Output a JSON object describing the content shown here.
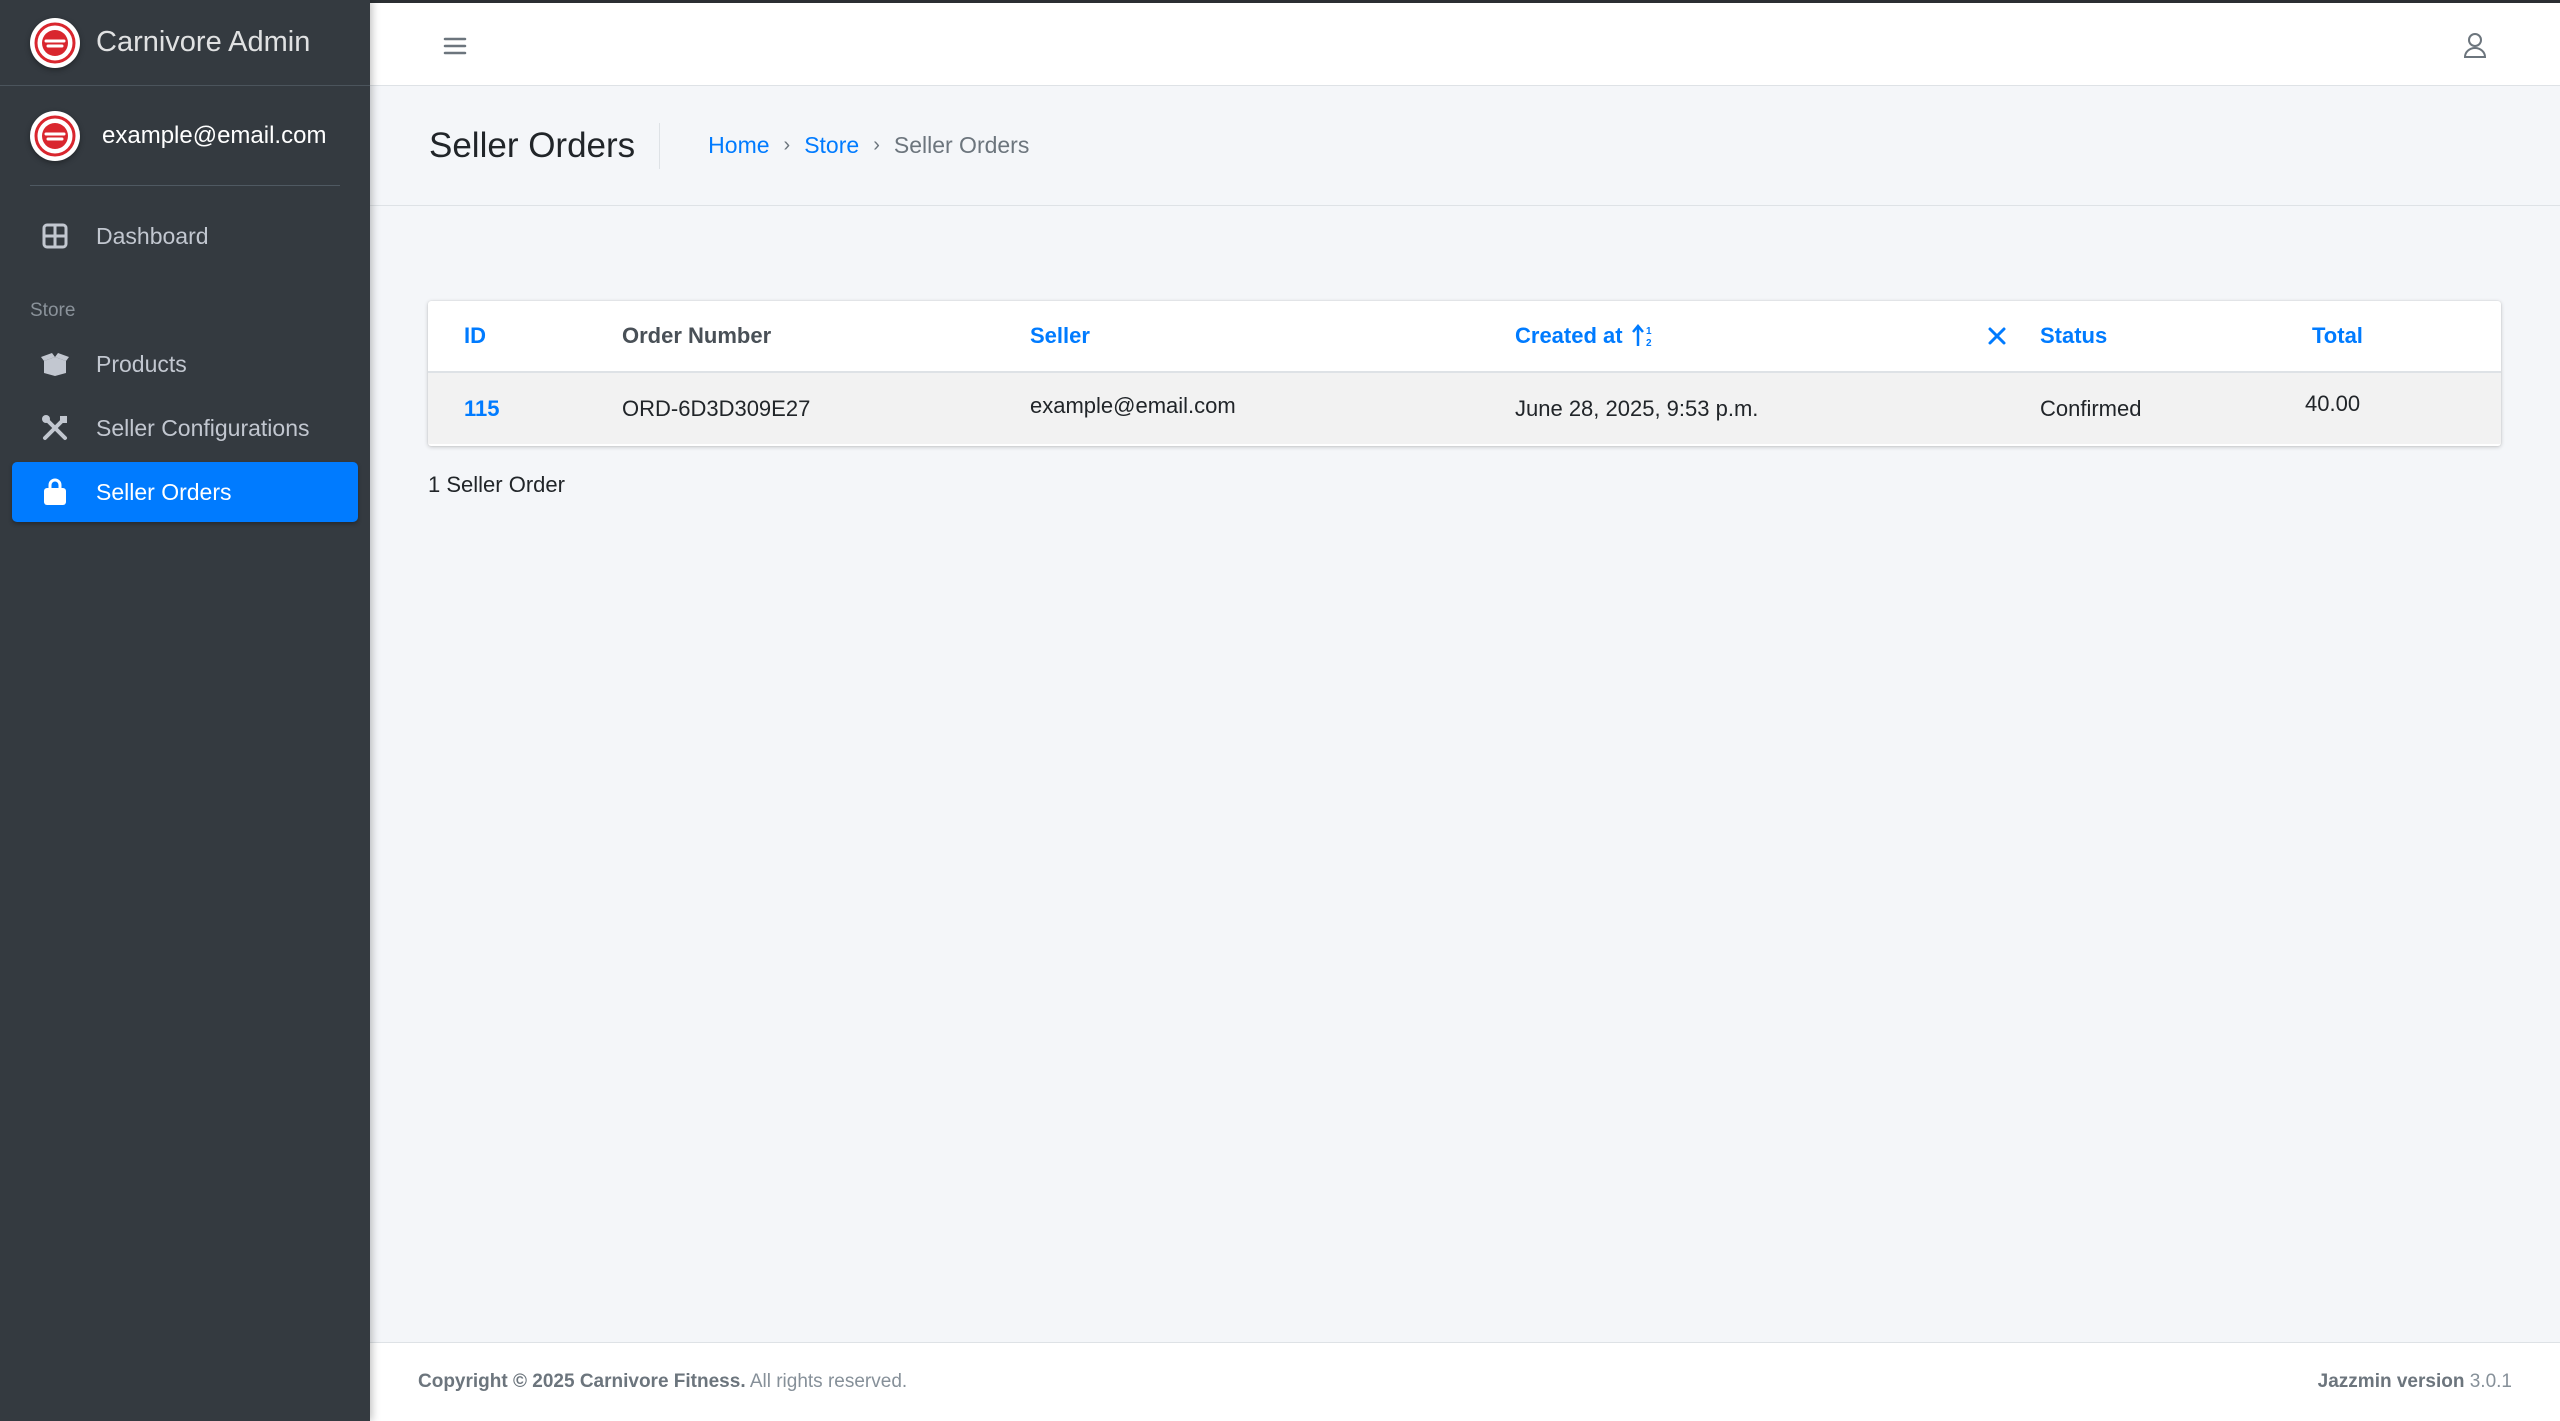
{
  "app": {
    "brand": "Carnivore Admin",
    "user_email": "example@email.com"
  },
  "sidebar": {
    "items": [
      {
        "label": "Dashboard",
        "icon": "grid-icon"
      },
      {
        "label": "Products",
        "icon": "box-open-icon"
      },
      {
        "label": "Seller Configurations",
        "icon": "tools-icon"
      },
      {
        "label": "Seller Orders",
        "icon": "shopping-bag-icon",
        "active": true
      }
    ],
    "section_header": "Store"
  },
  "header": {
    "title": "Seller Orders",
    "breadcrumb": {
      "home": "Home",
      "store": "Store",
      "current": "Seller Orders",
      "separator": "›"
    }
  },
  "table": {
    "columns": {
      "id": "ID",
      "order_number": "Order Number",
      "seller": "Seller",
      "created_at": "Created at",
      "status": "Status",
      "total": "Total"
    },
    "rows": [
      {
        "id": "115",
        "order_number": "ORD-6D3D309E27",
        "seller": "example@email.com",
        "created_at": "June 28, 2025, 9:53 p.m.",
        "status": "Confirmed",
        "total": "40.00"
      }
    ],
    "summary": "1 Seller Order"
  },
  "footer": {
    "copyright_bold": "Copyright © 2025 Carnivore Fitness.",
    "copyright_rest": " All rights reserved.",
    "version_label": "Jazzmin version",
    "version_value": " 3.0.1"
  },
  "colors": {
    "sidebar_bg": "#343a40",
    "accent": "#007bff",
    "content_bg": "#f4f6f9",
    "logo_red": "#d9262e"
  }
}
